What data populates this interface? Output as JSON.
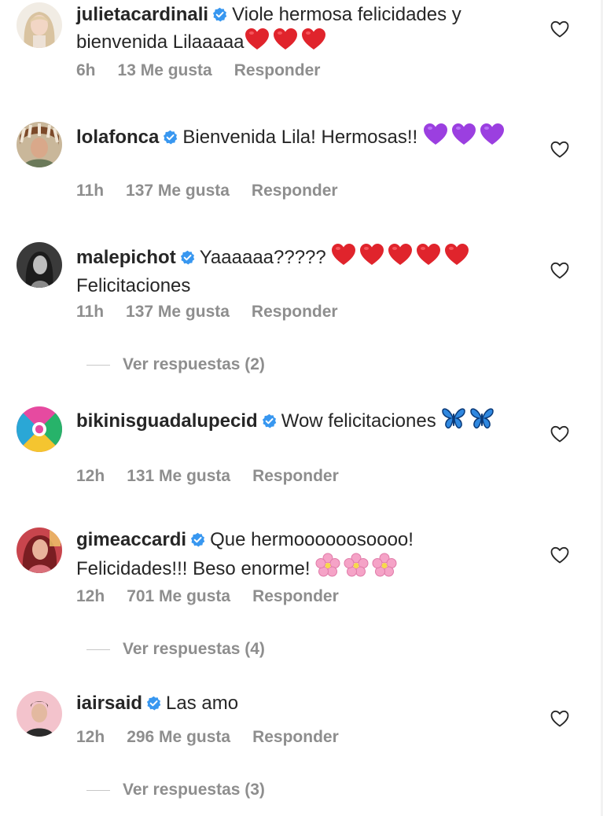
{
  "comments": [
    {
      "username": "julietacardinali",
      "text": "Viole hermosa felicidades y bienvenida Lilaaaaa",
      "emojis": [
        "red-heart",
        "red-heart",
        "red-heart"
      ],
      "time": "6h",
      "likes": "13 Me gusta",
      "reply": "Responder",
      "verified": true
    },
    {
      "username": "lolafonca",
      "text": "Bienvenida Lila! Hermosas!!",
      "emojis": [
        "purple-heart",
        "purple-heart",
        "purple-heart"
      ],
      "time": "11h",
      "likes": "137 Me gusta",
      "reply": "Responder",
      "verified": true
    },
    {
      "username": "malepichot",
      "text": "Yaaaaaa?????",
      "text2": "Felicitaciones",
      "emojis": [
        "red-heart",
        "red-heart",
        "red-heart",
        "red-heart",
        "red-heart"
      ],
      "time": "11h",
      "likes": "137 Me gusta",
      "reply": "Responder",
      "verified": true,
      "view_replies": "Ver respuestas (2)"
    },
    {
      "username": "bikinisguadalupecid",
      "text": "Wow felicitaciones",
      "emojis": [
        "butterfly",
        "butterfly"
      ],
      "time": "12h",
      "likes": "131 Me gusta",
      "reply": "Responder",
      "verified": true
    },
    {
      "username": "gimeaccardi",
      "text": "Que hermoooooosoooo!",
      "text2": "Felicidades!!! Beso enorme!",
      "emojis": [
        "cherry-blossom",
        "cherry-blossom",
        "cherry-blossom"
      ],
      "time": "12h",
      "likes": "701 Me gusta",
      "reply": "Responder",
      "verified": true,
      "view_replies": "Ver respuestas (4)"
    },
    {
      "username": "iairsaid",
      "text": "Las amo",
      "time": "12h",
      "likes": "296 Me gusta",
      "reply": "Responder",
      "verified": true,
      "view_replies": "Ver respuestas (3)"
    }
  ],
  "colors": {
    "text": "#262626",
    "meta": "#8e8e8e",
    "verified": "#3897f0",
    "red_heart": "#e0242c",
    "purple_heart": "#9b3fe0",
    "butterfly": "#2f88e0",
    "blossom": "#f5a3c7"
  }
}
